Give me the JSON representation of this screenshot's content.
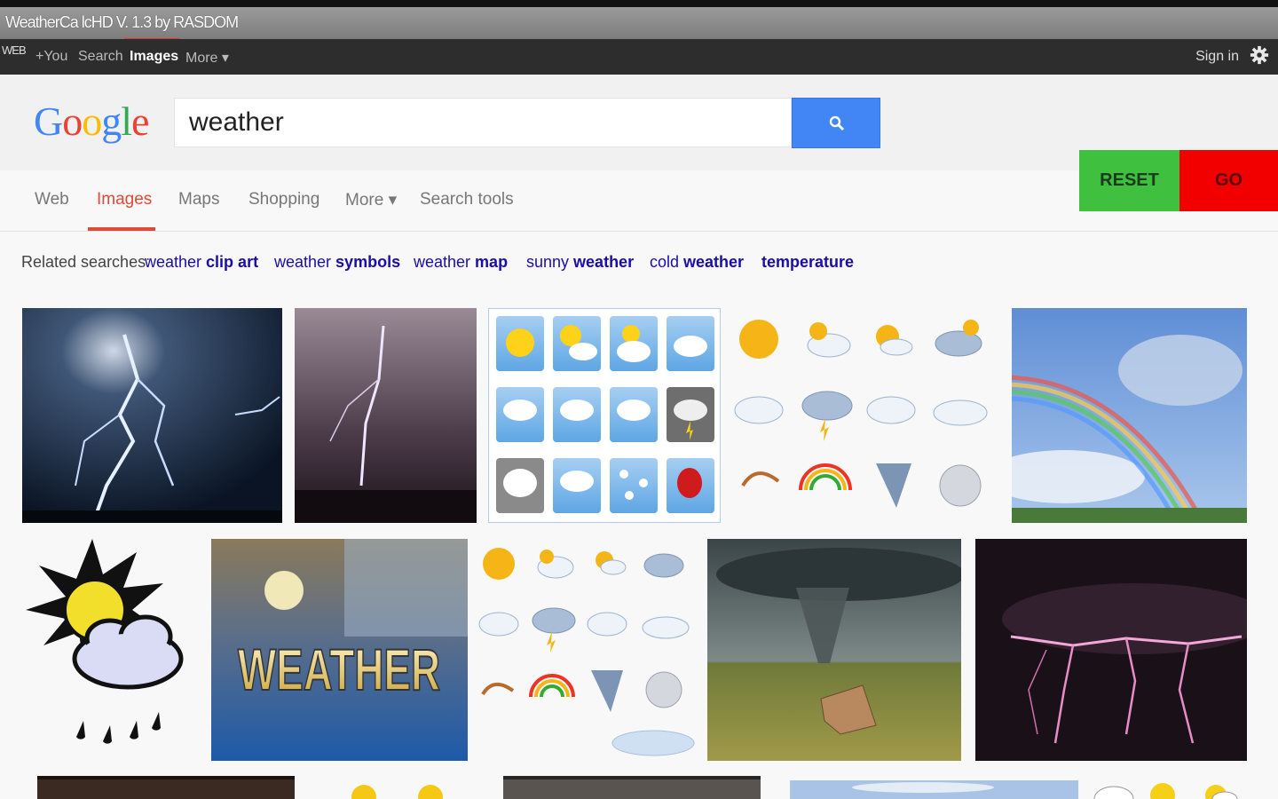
{
  "window": {
    "title": "WeatherCa lcHD V. 1.3 by RASDOM"
  },
  "gbar": {
    "web_label": "WEB",
    "items": [
      "+You",
      "Search",
      "Images",
      "More ▾"
    ],
    "sign_in": "Sign in"
  },
  "search": {
    "logo": [
      "G",
      "o",
      "o",
      "g",
      "l",
      "e"
    ],
    "query": "weather"
  },
  "controls": {
    "reset": "RESET",
    "go": "GO"
  },
  "tabs": [
    {
      "label": "Web"
    },
    {
      "label": "Images",
      "active": true
    },
    {
      "label": "Maps"
    },
    {
      "label": "Shopping"
    },
    {
      "label": "More ▾"
    },
    {
      "label": "Search tools"
    }
  ],
  "related": {
    "label": "Related searches:",
    "items": [
      {
        "plain": "weather ",
        "bold": "clip art"
      },
      {
        "plain": "weather ",
        "bold": "symbols"
      },
      {
        "plain": "weather ",
        "bold": "map"
      },
      {
        "plain": "sunny ",
        "bold": "weather"
      },
      {
        "plain": "cold ",
        "bold": "weather"
      },
      {
        "plain": "",
        "bold": "temperature"
      }
    ]
  },
  "images": {
    "banner_text": "WEATHER"
  },
  "colors": {
    "accent_red": "#dd4b39",
    "search_blue": "#4285f4",
    "reset_green": "#3fc03f",
    "go_red": "#f20000",
    "link_blue": "#1a0dab"
  }
}
